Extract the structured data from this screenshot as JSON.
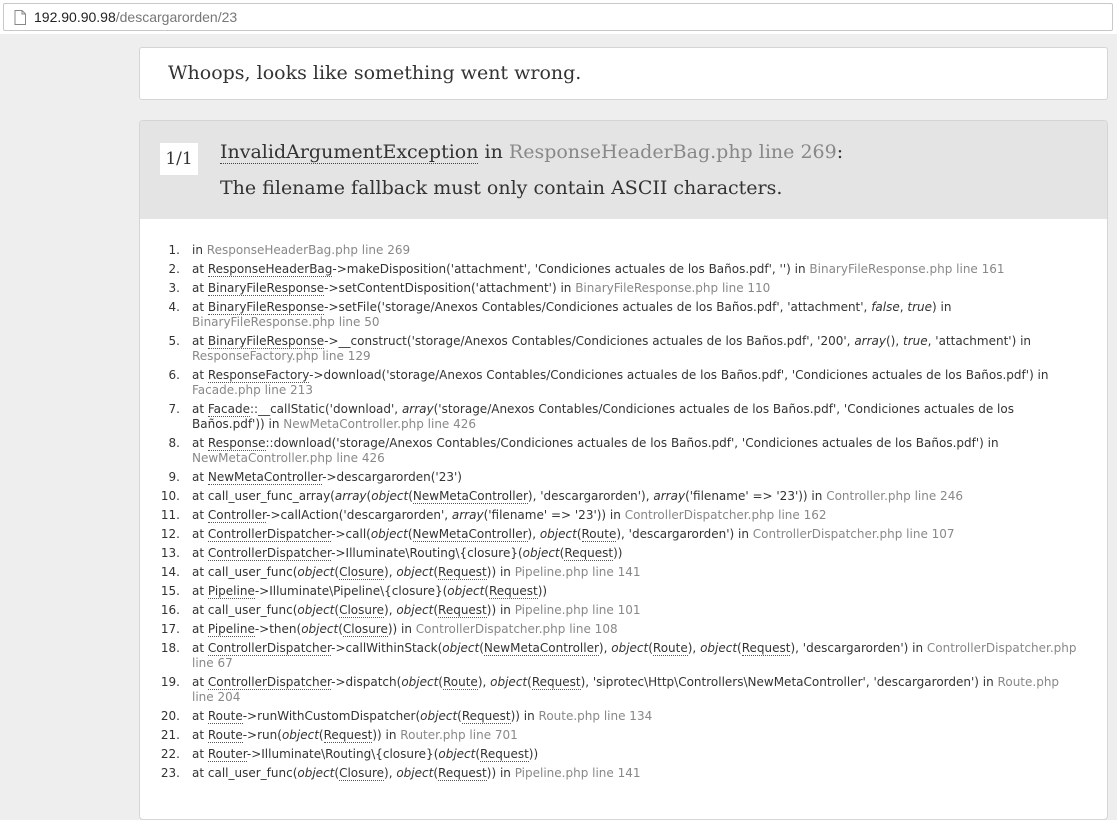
{
  "browser": {
    "url_host": "192.90.90.98",
    "url_path": "/descargarorden/23"
  },
  "error": {
    "headline": "Whoops, looks like something went wrong.",
    "counter": "1/1",
    "exception_class": "InvalidArgumentException",
    "in_word": "in",
    "location": "ResponseHeaderBag.php line 269",
    "colon": ":",
    "message": "The filename fallback must only contain ASCII characters."
  },
  "trace": [
    {
      "n": "1.",
      "parts": [
        [
          "t",
          "in "
        ],
        [
          "f",
          "ResponseHeaderBag.php line 269"
        ]
      ]
    },
    {
      "n": "2.",
      "parts": [
        [
          "t",
          "at "
        ],
        [
          "a",
          "ResponseHeaderBag"
        ],
        [
          "t",
          "->makeDisposition('attachment', 'Condiciones actuales de los Baños.pdf', '') in "
        ],
        [
          "f",
          "BinaryFileResponse.php line 161"
        ]
      ]
    },
    {
      "n": "3.",
      "parts": [
        [
          "t",
          "at "
        ],
        [
          "a",
          "BinaryFileResponse"
        ],
        [
          "t",
          "->setContentDisposition('attachment') in "
        ],
        [
          "f",
          "BinaryFileResponse.php line 110"
        ]
      ]
    },
    {
      "n": "4.",
      "parts": [
        [
          "t",
          "at "
        ],
        [
          "a",
          "BinaryFileResponse"
        ],
        [
          "t",
          "->setFile('storage/Anexos Contables/Condiciones actuales de los Baños.pdf', 'attachment', "
        ],
        [
          "i",
          "false"
        ],
        [
          "t",
          ", "
        ],
        [
          "i",
          "true"
        ],
        [
          "t",
          ") in "
        ],
        [
          "f",
          "BinaryFileResponse.php line 50"
        ]
      ]
    },
    {
      "n": "5.",
      "parts": [
        [
          "t",
          "at "
        ],
        [
          "a",
          "BinaryFileResponse"
        ],
        [
          "t",
          "->__construct('storage/Anexos Contables/Condiciones actuales de los Baños.pdf', '200', "
        ],
        [
          "i",
          "array"
        ],
        [
          "t",
          "(), "
        ],
        [
          "i",
          "true"
        ],
        [
          "t",
          ", 'attachment') in "
        ],
        [
          "f",
          "ResponseFactory.php line 129"
        ]
      ]
    },
    {
      "n": "6.",
      "parts": [
        [
          "t",
          "at "
        ],
        [
          "a",
          "ResponseFactory"
        ],
        [
          "t",
          "->download('storage/Anexos Contables/Condiciones actuales de los Baños.pdf', 'Condiciones actuales de los Baños.pdf') in "
        ],
        [
          "f",
          "Facade.php line 213"
        ]
      ]
    },
    {
      "n": "7.",
      "parts": [
        [
          "t",
          "at "
        ],
        [
          "a",
          "Facade"
        ],
        [
          "t",
          "::__callStatic('download', "
        ],
        [
          "i",
          "array"
        ],
        [
          "t",
          "('storage/Anexos Contables/Condiciones actuales de los Baños.pdf', 'Condiciones actuales de los Baños.pdf')) in "
        ],
        [
          "f",
          "NewMetaController.php line 426"
        ]
      ]
    },
    {
      "n": "8.",
      "parts": [
        [
          "t",
          "at "
        ],
        [
          "a",
          "Response"
        ],
        [
          "t",
          "::download('storage/Anexos Contables/Condiciones actuales de los Baños.pdf', 'Condiciones actuales de los Baños.pdf') in "
        ],
        [
          "f",
          "NewMetaController.php line 426"
        ]
      ]
    },
    {
      "n": "9.",
      "parts": [
        [
          "t",
          "at "
        ],
        [
          "a",
          "NewMetaController"
        ],
        [
          "t",
          "->descargarorden('23')"
        ]
      ]
    },
    {
      "n": "10.",
      "parts": [
        [
          "t",
          "at call_user_func_array("
        ],
        [
          "i",
          "array"
        ],
        [
          "t",
          "("
        ],
        [
          "i",
          "object"
        ],
        [
          "t",
          "("
        ],
        [
          "a",
          "NewMetaController"
        ],
        [
          "t",
          "), 'descargarorden'), "
        ],
        [
          "i",
          "array"
        ],
        [
          "t",
          "('filename' => '23')) in "
        ],
        [
          "f",
          "Controller.php line 246"
        ]
      ]
    },
    {
      "n": "11.",
      "parts": [
        [
          "t",
          "at "
        ],
        [
          "a",
          "Controller"
        ],
        [
          "t",
          "->callAction('descargarorden', "
        ],
        [
          "i",
          "array"
        ],
        [
          "t",
          "('filename' => '23')) in "
        ],
        [
          "f",
          "ControllerDispatcher.php line 162"
        ]
      ]
    },
    {
      "n": "12.",
      "parts": [
        [
          "t",
          "at "
        ],
        [
          "a",
          "ControllerDispatcher"
        ],
        [
          "t",
          "->call("
        ],
        [
          "i",
          "object"
        ],
        [
          "t",
          "("
        ],
        [
          "a",
          "NewMetaController"
        ],
        [
          "t",
          "), "
        ],
        [
          "i",
          "object"
        ],
        [
          "t",
          "("
        ],
        [
          "a",
          "Route"
        ],
        [
          "t",
          "), 'descargarorden') in "
        ],
        [
          "f",
          "ControllerDispatcher.php line 107"
        ]
      ]
    },
    {
      "n": "13.",
      "parts": [
        [
          "t",
          "at "
        ],
        [
          "a",
          "ControllerDispatcher"
        ],
        [
          "t",
          "->Illuminate\\Routing\\{closure}("
        ],
        [
          "i",
          "object"
        ],
        [
          "t",
          "("
        ],
        [
          "a",
          "Request"
        ],
        [
          "t",
          "))"
        ]
      ]
    },
    {
      "n": "14.",
      "parts": [
        [
          "t",
          "at call_user_func("
        ],
        [
          "i",
          "object"
        ],
        [
          "t",
          "("
        ],
        [
          "a",
          "Closure"
        ],
        [
          "t",
          "), "
        ],
        [
          "i",
          "object"
        ],
        [
          "t",
          "("
        ],
        [
          "a",
          "Request"
        ],
        [
          "t",
          ")) in "
        ],
        [
          "f",
          "Pipeline.php line 141"
        ]
      ]
    },
    {
      "n": "15.",
      "parts": [
        [
          "t",
          "at "
        ],
        [
          "a",
          "Pipeline"
        ],
        [
          "t",
          "->Illuminate\\Pipeline\\{closure}("
        ],
        [
          "i",
          "object"
        ],
        [
          "t",
          "("
        ],
        [
          "a",
          "Request"
        ],
        [
          "t",
          "))"
        ]
      ]
    },
    {
      "n": "16.",
      "parts": [
        [
          "t",
          "at call_user_func("
        ],
        [
          "i",
          "object"
        ],
        [
          "t",
          "("
        ],
        [
          "a",
          "Closure"
        ],
        [
          "t",
          "), "
        ],
        [
          "i",
          "object"
        ],
        [
          "t",
          "("
        ],
        [
          "a",
          "Request"
        ],
        [
          "t",
          ")) in "
        ],
        [
          "f",
          "Pipeline.php line 101"
        ]
      ]
    },
    {
      "n": "17.",
      "parts": [
        [
          "t",
          "at "
        ],
        [
          "a",
          "Pipeline"
        ],
        [
          "t",
          "->then("
        ],
        [
          "i",
          "object"
        ],
        [
          "t",
          "("
        ],
        [
          "a",
          "Closure"
        ],
        [
          "t",
          ")) in "
        ],
        [
          "f",
          "ControllerDispatcher.php line 108"
        ]
      ]
    },
    {
      "n": "18.",
      "parts": [
        [
          "t",
          "at "
        ],
        [
          "a",
          "ControllerDispatcher"
        ],
        [
          "t",
          "->callWithinStack("
        ],
        [
          "i",
          "object"
        ],
        [
          "t",
          "("
        ],
        [
          "a",
          "NewMetaController"
        ],
        [
          "t",
          "), "
        ],
        [
          "i",
          "object"
        ],
        [
          "t",
          "("
        ],
        [
          "a",
          "Route"
        ],
        [
          "t",
          "), "
        ],
        [
          "i",
          "object"
        ],
        [
          "t",
          "("
        ],
        [
          "a",
          "Request"
        ],
        [
          "t",
          "), 'descargarorden') in "
        ],
        [
          "f",
          "ControllerDispatcher.php line 67"
        ]
      ]
    },
    {
      "n": "19.",
      "parts": [
        [
          "t",
          "at "
        ],
        [
          "a",
          "ControllerDispatcher"
        ],
        [
          "t",
          "->dispatch("
        ],
        [
          "i",
          "object"
        ],
        [
          "t",
          "("
        ],
        [
          "a",
          "Route"
        ],
        [
          "t",
          "), "
        ],
        [
          "i",
          "object"
        ],
        [
          "t",
          "("
        ],
        [
          "a",
          "Request"
        ],
        [
          "t",
          "), 'siprotec\\Http\\Controllers\\NewMetaController', 'descargarorden') in "
        ],
        [
          "f",
          "Route.php line 204"
        ]
      ]
    },
    {
      "n": "20.",
      "parts": [
        [
          "t",
          "at "
        ],
        [
          "a",
          "Route"
        ],
        [
          "t",
          "->runWithCustomDispatcher("
        ],
        [
          "i",
          "object"
        ],
        [
          "t",
          "("
        ],
        [
          "a",
          "Request"
        ],
        [
          "t",
          ")) in "
        ],
        [
          "f",
          "Route.php line 134"
        ]
      ]
    },
    {
      "n": "21.",
      "parts": [
        [
          "t",
          "at "
        ],
        [
          "a",
          "Route"
        ],
        [
          "t",
          "->run("
        ],
        [
          "i",
          "object"
        ],
        [
          "t",
          "("
        ],
        [
          "a",
          "Request"
        ],
        [
          "t",
          ")) in "
        ],
        [
          "f",
          "Router.php line 701"
        ]
      ]
    },
    {
      "n": "22.",
      "parts": [
        [
          "t",
          "at "
        ],
        [
          "a",
          "Router"
        ],
        [
          "t",
          "->Illuminate\\Routing\\{closure}("
        ],
        [
          "i",
          "object"
        ],
        [
          "t",
          "("
        ],
        [
          "a",
          "Request"
        ],
        [
          "t",
          "))"
        ]
      ]
    },
    {
      "n": "23.",
      "parts": [
        [
          "t",
          "at call_user_func("
        ],
        [
          "i",
          "object"
        ],
        [
          "t",
          "("
        ],
        [
          "a",
          "Closure"
        ],
        [
          "t",
          "), "
        ],
        [
          "i",
          "object"
        ],
        [
          "t",
          "("
        ],
        [
          "a",
          "Request"
        ],
        [
          "t",
          ")) in "
        ],
        [
          "f",
          "Pipeline.php line 141"
        ]
      ]
    }
  ]
}
